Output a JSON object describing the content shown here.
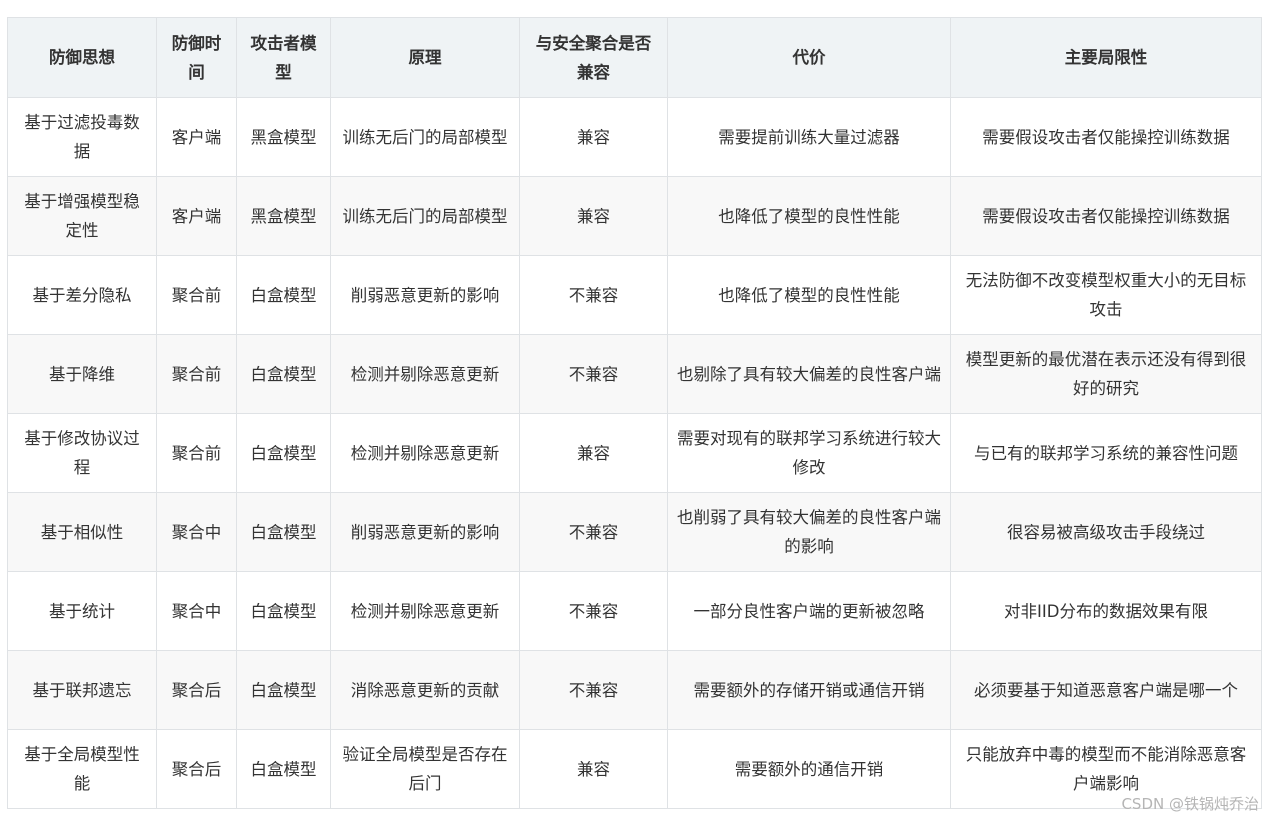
{
  "headers": [
    "防御思想",
    "防御时间",
    "攻击者模型",
    "原理",
    "与安全聚合是否兼容",
    "代价",
    "主要局限性"
  ],
  "rows": [
    [
      "基于过滤投毒数据",
      "客户端",
      "黑盒模型",
      "训练无后门的局部模型",
      "兼容",
      "需要提前训练大量过滤器",
      "需要假设攻击者仅能操控训练数据"
    ],
    [
      "基于增强模型稳定性",
      "客户端",
      "黑盒模型",
      "训练无后门的局部模型",
      "兼容",
      "也降低了模型的良性性能",
      "需要假设攻击者仅能操控训练数据"
    ],
    [
      "基于差分隐私",
      "聚合前",
      "白盒模型",
      "削弱恶意更新的影响",
      "不兼容",
      "也降低了模型的良性性能",
      "无法防御不改变模型权重大小的无目标攻击"
    ],
    [
      "基于降维",
      "聚合前",
      "白盒模型",
      "检测并剔除恶意更新",
      "不兼容",
      "也剔除了具有较大偏差的良性客户端",
      "模型更新的最优潜在表示还没有得到很好的研究"
    ],
    [
      "基于修改协议过程",
      "聚合前",
      "白盒模型",
      "检测并剔除恶意更新",
      "兼容",
      "需要对现有的联邦学习系统进行较大修改",
      "与已有的联邦学习系统的兼容性问题"
    ],
    [
      "基于相似性",
      "聚合中",
      "白盒模型",
      "削弱恶意更新的影响",
      "不兼容",
      "也削弱了具有较大偏差的良性客户端的影响",
      "很容易被高级攻击手段绕过"
    ],
    [
      "基于统计",
      "聚合中",
      "白盒模型",
      "检测并剔除恶意更新",
      "不兼容",
      "一部分良性客户端的更新被忽略",
      "对非IID分布的数据效果有限"
    ],
    [
      "基于联邦遗忘",
      "聚合后",
      "白盒模型",
      "消除恶意更新的贡献",
      "不兼容",
      "需要额外的存储开销或通信开销",
      "必须要基于知道恶意客户端是哪一个"
    ],
    [
      "基于全局模型性能",
      "聚合后",
      "白盒模型",
      "验证全局模型是否存在后门",
      "兼容",
      "需要额外的通信开销",
      "只能放弃中毒的模型而不能消除恶意客户端影响"
    ]
  ],
  "watermark": "CSDN @铁锅炖乔治"
}
